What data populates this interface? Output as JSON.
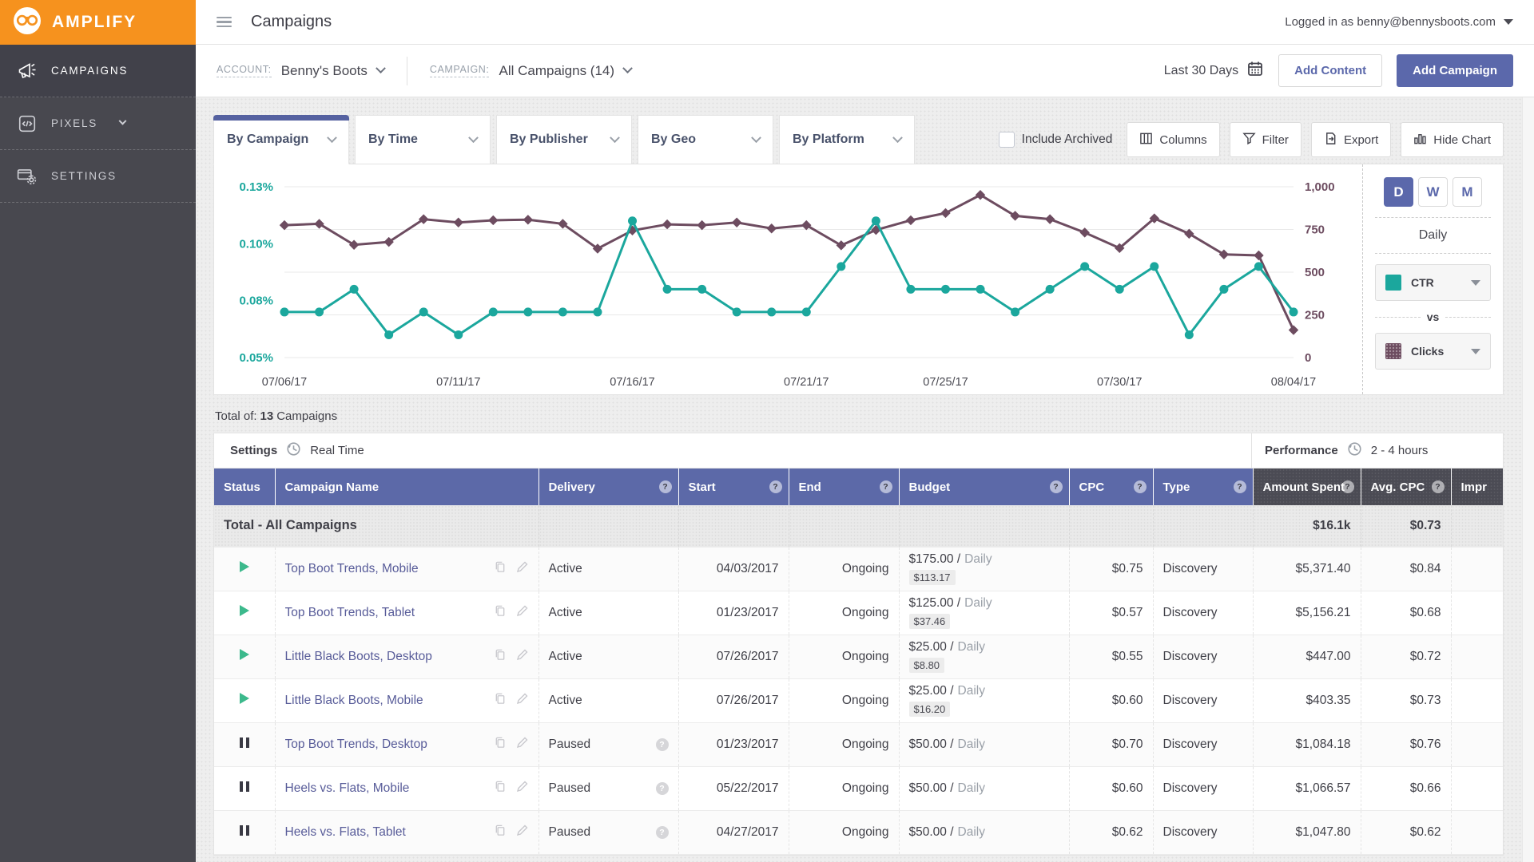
{
  "app": {
    "brand": "AMPLIFY",
    "page_title": "Campaigns",
    "logged_in_text": "Logged in as benny@bennysboots.com"
  },
  "colors": {
    "accent_purple": "#5c69a8",
    "teal": "#1ba79d",
    "maroon": "#6d4c60",
    "orange": "#f6921e",
    "green_play": "#3cb98c",
    "dark_header": "#4b4b54"
  },
  "sidebar": {
    "items": [
      {
        "label": "CAMPAIGNS",
        "icon": "megaphone-icon",
        "active": true,
        "chevron": false
      },
      {
        "label": "PIXELS",
        "icon": "pixels-code-icon",
        "active": false,
        "chevron": true
      },
      {
        "label": "SETTINGS",
        "icon": "billing-gear-icon",
        "active": false,
        "chevron": false
      }
    ]
  },
  "toolbar": {
    "account_label": "ACCOUNT:",
    "account_value": "Benny's Boots",
    "campaign_label": "CAMPAIGN:",
    "campaign_value": "All Campaigns (14)",
    "date_range": "Last 30 Days",
    "add_content_label": "Add Content",
    "add_campaign_label": "Add Campaign"
  },
  "tabs": [
    {
      "label": "By Campaign",
      "active": true
    },
    {
      "label": "By Time",
      "active": false
    },
    {
      "label": "By Publisher",
      "active": false
    },
    {
      "label": "By Geo",
      "active": false
    },
    {
      "label": "By Platform",
      "active": false
    }
  ],
  "controls": {
    "include_archived_label": "Include Archived",
    "include_archived_checked": false,
    "columns_label": "Columns",
    "filter_label": "Filter",
    "export_label": "Export",
    "hide_chart_label": "Hide Chart"
  },
  "chart_controls": {
    "granularity": [
      "D",
      "W",
      "M"
    ],
    "selected": "D",
    "granularity_label": "Daily",
    "metric1": "CTR",
    "vs_label": "vs",
    "metric2": "Clicks"
  },
  "chart_data": {
    "type": "line",
    "x": [
      "07/06/17",
      "07/07/17",
      "07/08/17",
      "07/09/17",
      "07/10/17",
      "07/11/17",
      "07/12/17",
      "07/13/17",
      "07/14/17",
      "07/15/17",
      "07/16/17",
      "07/17/17",
      "07/18/17",
      "07/19/17",
      "07/20/17",
      "07/21/17",
      "07/22/17",
      "07/23/17",
      "07/24/17",
      "07/25/17",
      "07/26/17",
      "07/27/17",
      "07/28/17",
      "07/29/17",
      "07/30/17",
      "07/31/17",
      "08/01/17",
      "08/02/17",
      "08/03/17",
      "08/04/17"
    ],
    "x_tick_labels": [
      "07/06/17",
      "07/11/17",
      "07/16/17",
      "07/21/17",
      "07/25/17",
      "07/30/17",
      "08/04/17"
    ],
    "x_tick_indices": [
      0,
      5,
      10,
      15,
      19,
      24,
      29
    ],
    "series": [
      {
        "name": "CTR",
        "axis": "left",
        "marker": "circle",
        "color": "#1ba79d",
        "values": [
          0.074,
          0.074,
          0.084,
          0.062,
          0.074,
          0.062,
          0.074,
          0.074,
          0.074,
          0.074,
          0.112,
          0.084,
          0.084,
          0.074,
          0.074,
          0.074,
          0.092,
          0.112,
          0.084,
          0.084,
          0.084,
          0.074,
          0.084,
          0.092,
          0.084,
          0.092,
          0.062,
          0.084,
          0.092,
          0.074
        ]
      },
      {
        "name": "Clicks",
        "axis": "right",
        "marker": "diamond",
        "color": "#6d4c60",
        "values": [
          775,
          783,
          660,
          677,
          810,
          791,
          804,
          807,
          783,
          638,
          744,
          780,
          775,
          791,
          756,
          775,
          657,
          747,
          804,
          846,
          952,
          830,
          810,
          732,
          641,
          815,
          725,
          604,
          598,
          161
        ]
      }
    ],
    "left_axis": {
      "tick_labels": [
        "0.13%",
        "0.10%",
        "0.08%",
        "0.05%"
      ],
      "tick_values": [
        0.13,
        0.1,
        0.08,
        0.05
      ],
      "unit": "%"
    },
    "right_axis": {
      "tick_labels": [
        "1,000",
        "750",
        "500",
        "250",
        "0"
      ],
      "range": [
        0,
        1000
      ]
    },
    "grid": true,
    "legend_position": "right-panel"
  },
  "table": {
    "total_line": {
      "prefix": "Total of:",
      "count": "13",
      "suffix": "Campaigns"
    },
    "settings_label": "Settings",
    "realtime_label": "Real Time",
    "performance_label": "Performance",
    "performance_delay": "2 - 4 hours",
    "columns": [
      {
        "label": "Status",
        "help": false,
        "dark": false
      },
      {
        "label": "Campaign Name",
        "help": false,
        "dark": false
      },
      {
        "label": "Delivery",
        "help": true,
        "dark": false
      },
      {
        "label": "Start",
        "help": true,
        "dark": false
      },
      {
        "label": "End",
        "help": true,
        "dark": false
      },
      {
        "label": "Budget",
        "help": true,
        "dark": false
      },
      {
        "label": "CPC",
        "help": true,
        "dark": false
      },
      {
        "label": "Type",
        "help": true,
        "dark": false
      },
      {
        "label": "Amount Spent",
        "help": true,
        "dark": true
      },
      {
        "label": "Avg. CPC",
        "help": true,
        "dark": true
      },
      {
        "label": "Impr",
        "help": false,
        "dark": true
      }
    ],
    "total_row": {
      "label": "Total - All Campaigns",
      "amount_spent": "$16.1k",
      "avg_cpc": "$0.73"
    },
    "rows": [
      {
        "status": "active",
        "name": "Top Boot Trends, Mobile",
        "delivery": "Active",
        "delivery_help": false,
        "start": "04/03/2017",
        "end": "Ongoing",
        "budget": "$175.00 /",
        "budget_period": "Daily",
        "budget_spent": "$113.17",
        "cpc": "$0.75",
        "type": "Discovery",
        "amount_spent": "$5,371.40",
        "avg_cpc": "$0.84"
      },
      {
        "status": "active",
        "name": "Top Boot Trends, Tablet",
        "delivery": "Active",
        "delivery_help": false,
        "start": "01/23/2017",
        "end": "Ongoing",
        "budget": "$125.00 /",
        "budget_period": "Daily",
        "budget_spent": "$37.46",
        "cpc": "$0.57",
        "type": "Discovery",
        "amount_spent": "$5,156.21",
        "avg_cpc": "$0.68"
      },
      {
        "status": "active",
        "name": "Little Black Boots, Desktop",
        "delivery": "Active",
        "delivery_help": false,
        "start": "07/26/2017",
        "end": "Ongoing",
        "budget": "$25.00 /",
        "budget_period": "Daily",
        "budget_spent": "$8.80",
        "cpc": "$0.55",
        "type": "Discovery",
        "amount_spent": "$447.00",
        "avg_cpc": "$0.72"
      },
      {
        "status": "active",
        "name": "Little Black Boots, Mobile",
        "delivery": "Active",
        "delivery_help": false,
        "start": "07/26/2017",
        "end": "Ongoing",
        "budget": "$25.00 /",
        "budget_period": "Daily",
        "budget_spent": "$16.20",
        "cpc": "$0.60",
        "type": "Discovery",
        "amount_spent": "$403.35",
        "avg_cpc": "$0.73"
      },
      {
        "status": "paused",
        "name": "Top Boot Trends, Desktop",
        "delivery": "Paused",
        "delivery_help": true,
        "start": "01/23/2017",
        "end": "Ongoing",
        "budget": "$50.00 /",
        "budget_period": "Daily",
        "budget_spent": "",
        "cpc": "$0.70",
        "type": "Discovery",
        "amount_spent": "$1,084.18",
        "avg_cpc": "$0.76"
      },
      {
        "status": "paused",
        "name": "Heels vs. Flats, Mobile",
        "delivery": "Paused",
        "delivery_help": true,
        "start": "05/22/2017",
        "end": "Ongoing",
        "budget": "$50.00 /",
        "budget_period": "Daily",
        "budget_spent": "",
        "cpc": "$0.60",
        "type": "Discovery",
        "amount_spent": "$1,066.57",
        "avg_cpc": "$0.66"
      },
      {
        "status": "paused",
        "name": "Heels vs. Flats, Tablet",
        "delivery": "Paused",
        "delivery_help": true,
        "start": "04/27/2017",
        "end": "Ongoing",
        "budget": "$50.00 /",
        "budget_period": "Daily",
        "budget_spent": "",
        "cpc": "$0.62",
        "type": "Discovery",
        "amount_spent": "$1,047.80",
        "avg_cpc": "$0.62"
      }
    ]
  }
}
